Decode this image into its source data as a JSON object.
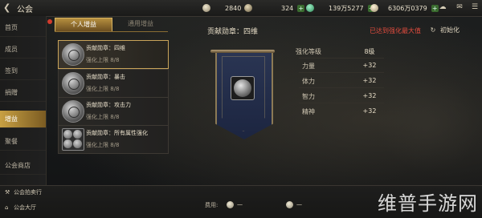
{
  "header": {
    "title": "公会",
    "resources": [
      {
        "icon": "silver-ingot-icon",
        "value": "2840"
      },
      {
        "icon": "copper-coin-icon",
        "value": "324"
      },
      {
        "icon": "jade-icon",
        "value": "139万5277"
      },
      {
        "icon": "silver-coin-icon",
        "value": "6306万0379"
      }
    ]
  },
  "sidebar": {
    "items": [
      {
        "label": "首页"
      },
      {
        "label": "成员"
      },
      {
        "label": "签到"
      },
      {
        "label": "捐赠"
      },
      {
        "label": "增益",
        "active": true
      },
      {
        "label": "聚餐"
      },
      {
        "label": "公会商店"
      }
    ]
  },
  "tabs": [
    {
      "label": "个人增益",
      "active": true
    },
    {
      "label": "通用增益",
      "active": false
    }
  ],
  "medals": [
    {
      "name": "贡献勋章：四维",
      "sub": "强化上限 8/8",
      "selected": true
    },
    {
      "name": "贡献勋章：暴击",
      "sub": "强化上限 8/8",
      "selected": false
    },
    {
      "name": "贡献勋章：攻击力",
      "sub": "强化上限 8/8",
      "selected": false
    },
    {
      "name": "贡献勋章：所有属性强化",
      "sub": "强化上限 8/8",
      "selected": false
    }
  ],
  "detail": {
    "title": "贡献勋章：四维",
    "max_notice": "已达到强化最大值",
    "reset_label": "初始化",
    "stats": [
      {
        "key": "强化等级",
        "value": "8级"
      },
      {
        "key": "力量",
        "value": "+32"
      },
      {
        "key": "体力",
        "value": "+32"
      },
      {
        "key": "智力",
        "value": "+32"
      },
      {
        "key": "精神",
        "value": "+32"
      }
    ]
  },
  "bottom": {
    "auction_label": "公会拍卖行",
    "hall_label": "公会大厅",
    "cost_label": "费用:",
    "cost_values": [
      "一",
      "一"
    ]
  },
  "watermark": "维普手游网",
  "colors": {
    "accent_gold": "#c8a043",
    "alert_red": "#e24c3e",
    "banner_blue": "#2a3553"
  }
}
